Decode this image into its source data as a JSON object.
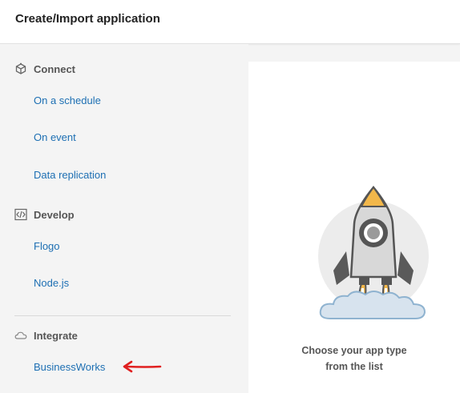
{
  "header": {
    "title": "Create/Import application"
  },
  "sidebar": {
    "connect": {
      "label": "Connect",
      "icon": "cube-icon",
      "items": [
        "On a schedule",
        "On event",
        "Data replication"
      ]
    },
    "develop": {
      "label": "Develop",
      "icon": "code-icon",
      "items": [
        "Flogo",
        "Node.js"
      ]
    },
    "integrate": {
      "label": "Integrate",
      "icon": "cloud-icon",
      "items": [
        "BusinessWorks"
      ]
    }
  },
  "main": {
    "illustration": "rocket-icon",
    "caption_line1": "Choose your app type",
    "caption_line2": "from the list"
  },
  "colors": {
    "link": "#1d6fb3",
    "arrow": "#e02020",
    "accent": "#f2b74a"
  }
}
